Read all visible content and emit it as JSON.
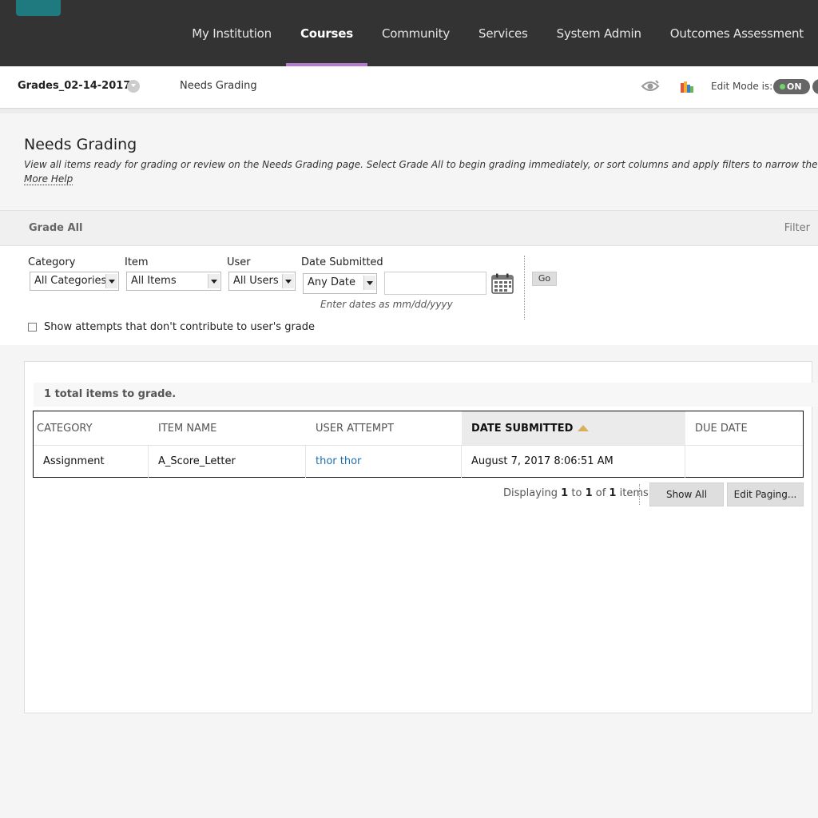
{
  "nav": {
    "items": [
      {
        "label": "My Institution"
      },
      {
        "label": "Courses"
      },
      {
        "label": "Community"
      },
      {
        "label": "Services"
      },
      {
        "label": "System Admin"
      },
      {
        "label": "Outcomes Assessment"
      }
    ],
    "active_index": 1,
    "active_color": "#b47ad1"
  },
  "breadcrumb": {
    "course": "Grades_02-14-2017",
    "page": "Needs Grading"
  },
  "edit_mode": {
    "label": "Edit Mode is:",
    "state": "ON"
  },
  "page": {
    "title": "Needs Grading",
    "description": "View all items ready for grading or review on the Needs Grading page. Select Grade All to begin grading immediately, or sort columns and apply filters to narrow the list.",
    "more_help": "More Help"
  },
  "actions": {
    "grade_all": "Grade All",
    "filter": "Filter"
  },
  "filters": {
    "category": {
      "label": "Category",
      "value": "All Categories"
    },
    "item": {
      "label": "Item",
      "value": "All Items"
    },
    "user": {
      "label": "User",
      "value": "All Users"
    },
    "date_submitted": {
      "label": "Date Submitted",
      "value": "Any Date",
      "hint": "Enter dates as mm/dd/yyyy"
    },
    "go": "Go",
    "show_attempts": {
      "label": "Show attempts that don't contribute to user's grade",
      "checked": false
    }
  },
  "results": {
    "total": "1 total items to grade.",
    "columns": [
      "CATEGORY",
      "ITEM NAME",
      "USER ATTEMPT",
      "DATE SUBMITTED",
      "DUE DATE"
    ],
    "sorted_column": "DATE SUBMITTED",
    "rows": [
      {
        "category": "Assignment",
        "item_name": "A_Score_Letter",
        "user_attempt": "thor thor",
        "date_submitted": "August 7, 2017 8:06:51 AM",
        "due_date": ""
      }
    ]
  },
  "paging": {
    "prefix": "Displaying",
    "from": "1",
    "to_word": "to",
    "to": "1",
    "of_word": "of",
    "total": "1",
    "suffix": "items",
    "show_all": "Show All",
    "edit_paging": "Edit Paging..."
  }
}
